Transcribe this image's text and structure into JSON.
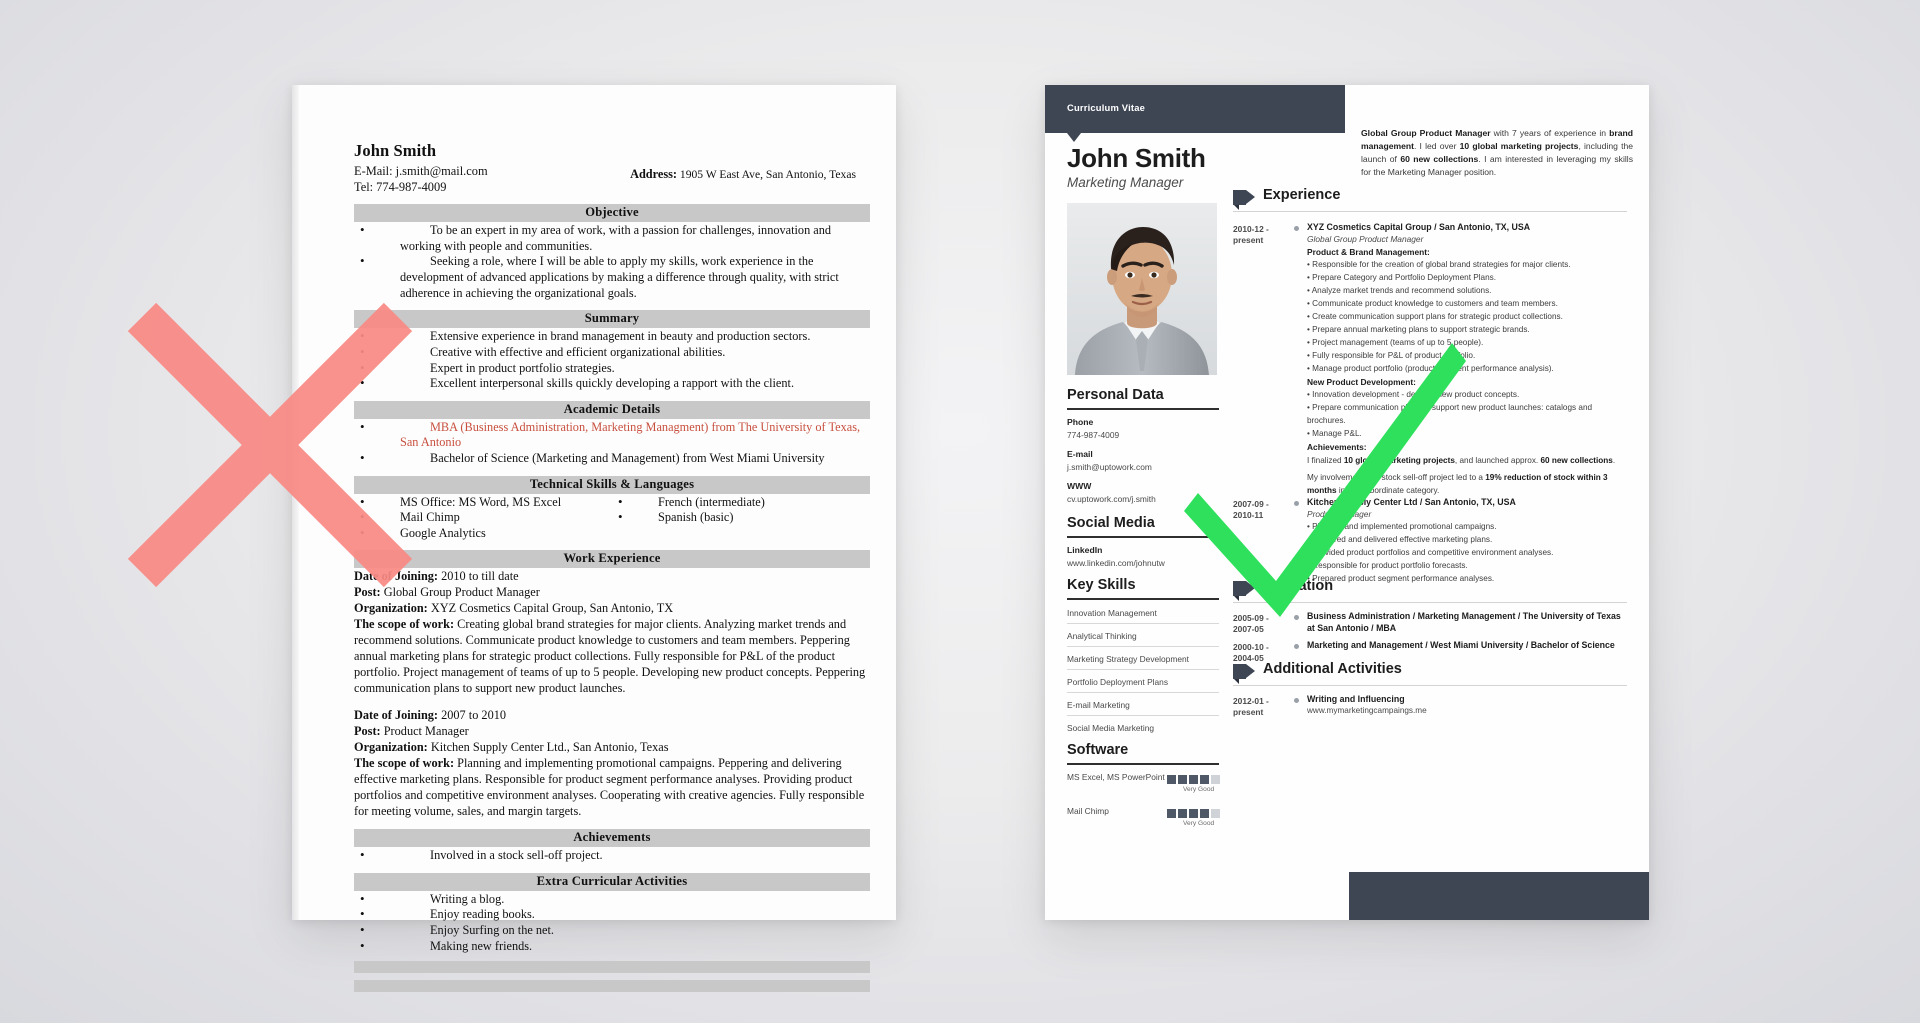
{
  "comparison": {
    "bad_mark": "red-x-mark",
    "good_mark": "green-check-mark"
  },
  "bad_resume": {
    "name": "John Smith",
    "email_line": "E-Mail: j.smith@mail.com",
    "tel_line": "Tel: 774-987-4009",
    "address_label": "Address:",
    "address_value": "1905 W East Ave, San Antonio, Texas",
    "sections": {
      "objective": {
        "heading": "Objective",
        "bullets": [
          "To be an expert in my area of work, with a passion for challenges, innovation and working with people and communities.",
          "Seeking a role, where I will be able to apply my skills, work experience in the development of advanced applications by making a difference through quality, with strict adherence in achieving the organizational goals."
        ]
      },
      "summary": {
        "heading": "Summary",
        "bullets": [
          "Extensive experience in brand management in beauty and production sectors.",
          "Creative with effective and efficient organizational abilities.",
          "Expert in product portfolio strategies.",
          "Excellent interpersonal skills quickly developing a rapport with the client."
        ]
      },
      "academic": {
        "heading": "Academic Details",
        "bullets": [
          "MBA (Business Administration, Marketing Managment) from The University of Texas, San Antonio",
          "Bachelor of Science (Marketing and Management) from West Miami University"
        ]
      },
      "skills": {
        "heading": "Technical Skills & Languages",
        "left": [
          "MS Office: MS Word, MS Excel",
          "Mail Chimp",
          "Google Analytics"
        ],
        "right": [
          "French (intermediate)",
          "Spanish (basic)"
        ]
      },
      "work": {
        "heading": "Work Experience",
        "jobs": [
          {
            "date_label": "Date of Joining:",
            "date_value": "2010 to till date",
            "post_label": "Post:",
            "post_value": "Global Group Product Manager",
            "org_label": "Organization:",
            "org_value": "XYZ Cosmetics Capital Group, San Antonio, TX",
            "scope_label": "The scope of work:",
            "scope_value": "Creating global brand strategies for major clients. Analyzing market trends and recommend solutions. Communicate product knowledge to customers and team members. Peppering annual marketing plans for strategic product collections. Fully responsible for P&L of the product portfolio. Project management of teams of up to 5 people. Developing new product concepts. Peppering communication plans  to support new product launches."
          },
          {
            "date_label": "Date of Joining:",
            "date_value": "2007 to 2010",
            "post_label": "Post:",
            "post_value": "Product Manager",
            "org_label": "Organization:",
            "org_value": "Kitchen Supply Center Ltd., San Antonio, Texas",
            "scope_label": "The scope of work:",
            "scope_value": "Planning and implementing promotional campaigns. Peppering and delivering effective marketing plans. Responsible for product segment performance analyses. Providing product portfolios and competitive environment analyses. Cooperating with creative agencies. Fully responsible for meeting volume, sales, and margin targets."
          }
        ]
      },
      "achievements": {
        "heading": "Achievements",
        "bullets": [
          "Involved in a stock sell-off project."
        ]
      },
      "extra": {
        "heading": "Extra Curricular Activities",
        "bullets": [
          "Writing a blog.",
          "Enjoy reading books.",
          "Enjoy Surfing on the net.",
          "Making new friends."
        ]
      }
    }
  },
  "good_resume": {
    "cv_tag": "Curriculum Vitae",
    "name": "John Smith",
    "role": "Marketing Manager",
    "summary_parts": {
      "p1": "Global Group Product Manager",
      "p2": " with 7 years of experience in ",
      "p3": "brand management",
      "p4": ". I led over ",
      "p5": "10 global marketing projects",
      "p6": ", including the launch of ",
      "p7": "60 new collections",
      "p8": ". I am interested in leveraging my skills for the Marketing Manager position."
    },
    "sidebar": {
      "personal_data": {
        "heading": "Personal Data",
        "fields": [
          {
            "label": "Phone",
            "value": "774-987-4009"
          },
          {
            "label": "E-mail",
            "value": "j.smith@uptowork.com"
          },
          {
            "label": "WWW",
            "value": "cv.uptowork.com/j.smith"
          }
        ]
      },
      "social_media": {
        "heading": "Social Media",
        "fields": [
          {
            "label": "LinkedIn",
            "value": "www.linkedin.com/johnutw"
          }
        ]
      },
      "key_skills": {
        "heading": "Key Skills",
        "items": [
          "Innovation Management",
          "Analytical Thinking",
          "Marketing Strategy Development",
          "Portfolio Deployment Plans",
          "E-mail Marketing",
          "Social Media Marketing"
        ]
      },
      "software": {
        "heading": "Software",
        "items": [
          {
            "name": "MS Excel, MS PowerPoint",
            "level": 4,
            "level_label": "Very Good"
          },
          {
            "name": "Mail Chimp",
            "level": 4,
            "level_label": "Very Good"
          }
        ]
      }
    },
    "experience": {
      "heading": "Experience",
      "entries": [
        {
          "date": "2010-12 -\npresent",
          "title": "XYZ Cosmetics Capital Group / San Antonio, TX, USA",
          "subtitle": "Global Group Product Manager",
          "group1_title": "Product & Brand Management:",
          "group1_items": [
            "Responsible for the creation of global brand strategies for major clients.",
            "Prepare Category and Portfolio Deployment Plans.",
            "Analyze market trends and recommend solutions.",
            "Communicate product knowledge to customers and team members.",
            "Create communication support plans for strategic product collections.",
            "Prepare annual marketing plans to support strategic brands.",
            "Project management (teams of up to 5 people).",
            "Fully responsible for P&L of product portfolio.",
            "Manage product portfolio (product segment performance analysis)."
          ],
          "group2_title": "New Product Development:",
          "group2_items": [
            "Innovation development - develop new product concepts.",
            "Prepare communication plans to support new product launches: catalogs and brochures.",
            "Manage P&L."
          ],
          "group3_title": "Achievements:",
          "achievement_1": {
            "a": "I finalized ",
            "b": "10 global marketing projects",
            "c": ", and launched approx. ",
            "d": "60 new collections",
            "e": "."
          },
          "achievement_2": {
            "a": "My involvement in a stock sell-off project led to a ",
            "b": "19% reduction of stock within 3 months",
            "c": " in the subordinate category."
          }
        },
        {
          "date": "2007-09 -\n2010-11",
          "title": "Kitchen Supply Center Ltd / San Antonio, TX, USA",
          "subtitle": "Product Manager",
          "items": [
            "Planned and implemented promotional campaigns.",
            "Prepared and delivered effective marketing plans.",
            "Provided product portfolios and competitive environment analyses.",
            "Responsible for product portfolio forecasts.",
            "Prepared product segment performance analyses."
          ]
        }
      ]
    },
    "education": {
      "heading": "Education",
      "entries": [
        {
          "date": "2005-09 -\n2007-05",
          "title": "Business Administration / Marketing Management / The University of Texas at San Antonio / MBA"
        },
        {
          "date": "2000-10 -\n2004-05",
          "title": "Marketing and Management / West Miami University / Bachelor of Science"
        }
      ]
    },
    "additional": {
      "heading": "Additional Activities",
      "entries": [
        {
          "date": "2012-01 -\npresent",
          "title": "Writing and Influencing",
          "link": "www.mymarketingcampaings.me"
        }
      ]
    }
  },
  "colors": {
    "dark_navy": "#3e4654",
    "red_x": "#f98a85",
    "green_check": "#2fe05c",
    "bar_gray": "#c8c8c8",
    "red_text": "#c8503f"
  }
}
